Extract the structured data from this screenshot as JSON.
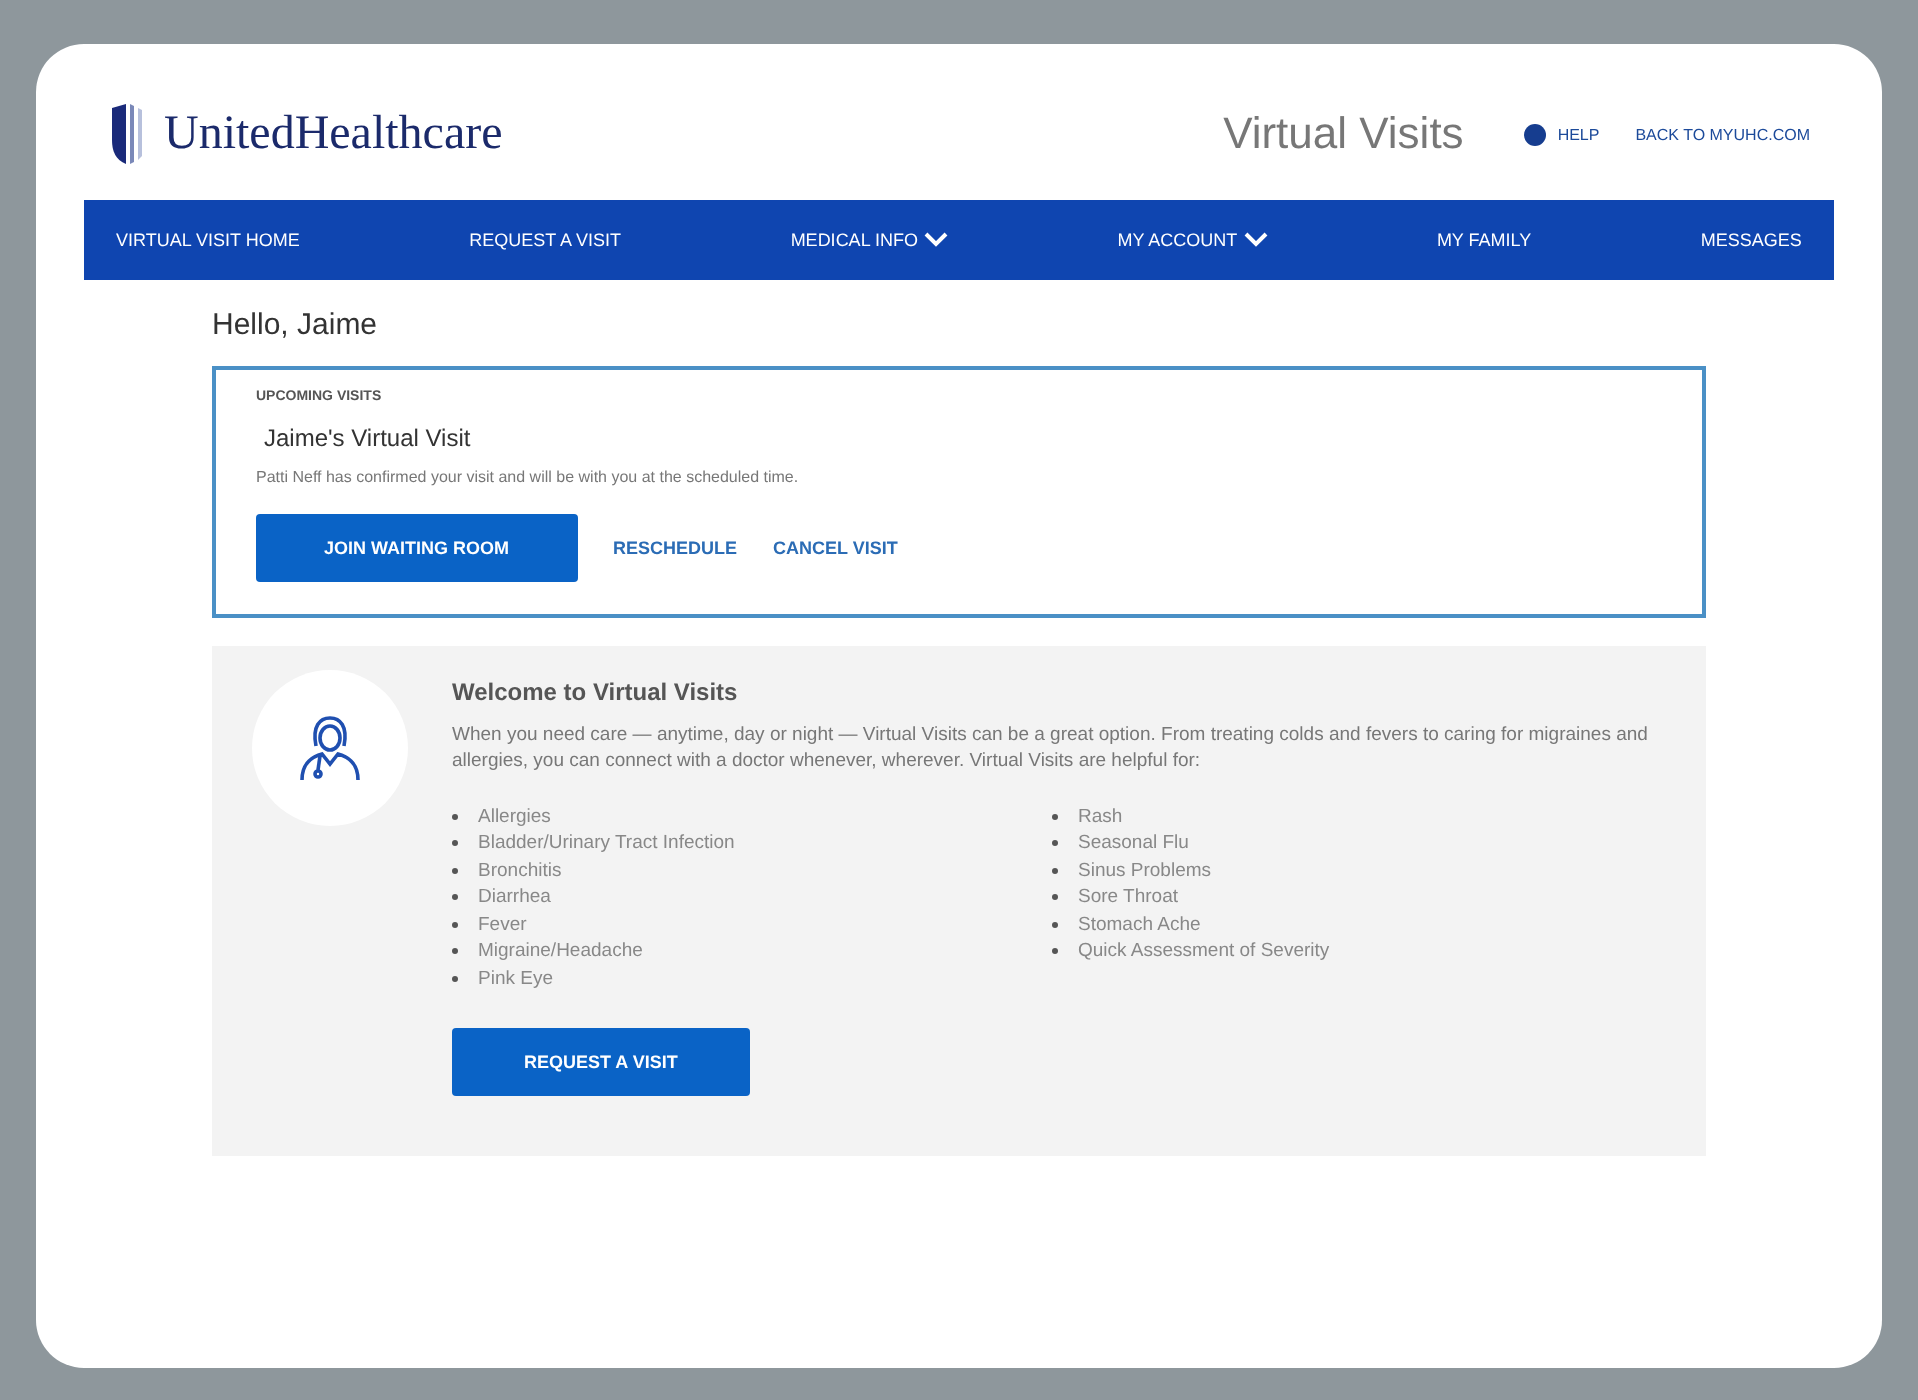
{
  "header": {
    "brand": "UnitedHealthcare",
    "product": "Virtual Visits",
    "links": [
      {
        "label": "HELP",
        "kind": "help"
      },
      {
        "label": "BACK TO MYUHC.COM",
        "kind": "plain"
      }
    ]
  },
  "nav": [
    {
      "label": "VIRTUAL VISIT HOME",
      "has_menu": false
    },
    {
      "label": "REQUEST A VISIT",
      "has_menu": false
    },
    {
      "label": "MEDICAL INFO",
      "has_menu": true
    },
    {
      "label": "MY ACCOUNT",
      "has_menu": true
    },
    {
      "label": "MY FAMILY",
      "has_menu": false
    },
    {
      "label": "MESSAGES",
      "has_menu": false
    }
  ],
  "greeting": "Hello, Jaime",
  "upcoming": {
    "heading": "UPCOMING VISITS",
    "title": "Jaime's Virtual Visit",
    "message": "Patti Neff has confirmed your visit and will be with you at the scheduled time.",
    "primary_button": "JOIN WAITING ROOM",
    "links": [
      "RESCHEDULE",
      "CANCEL VISIT"
    ]
  },
  "welcome": {
    "title": "Welcome to Virtual Visits",
    "body": "When you need care — anytime, day or night — Virtual Visits can be a great option. From treating colds and fevers to caring for migraines and allergies, you can connect with a doctor whenever, wherever. Virtual Visits are helpful for:",
    "list_1": [
      "Allergies",
      "Bladder/Urinary Tract Infection",
      "Bronchitis",
      "Diarrhea",
      "Fever",
      "Migraine/Headache",
      "Pink Eye"
    ],
    "list_2": [
      "Rash",
      "Seasonal Flu",
      "Sinus Problems",
      "Sore Throat",
      "Stomach Ache",
      "Quick Assessment of Severity"
    ],
    "button": "REQUEST A VISIT"
  }
}
